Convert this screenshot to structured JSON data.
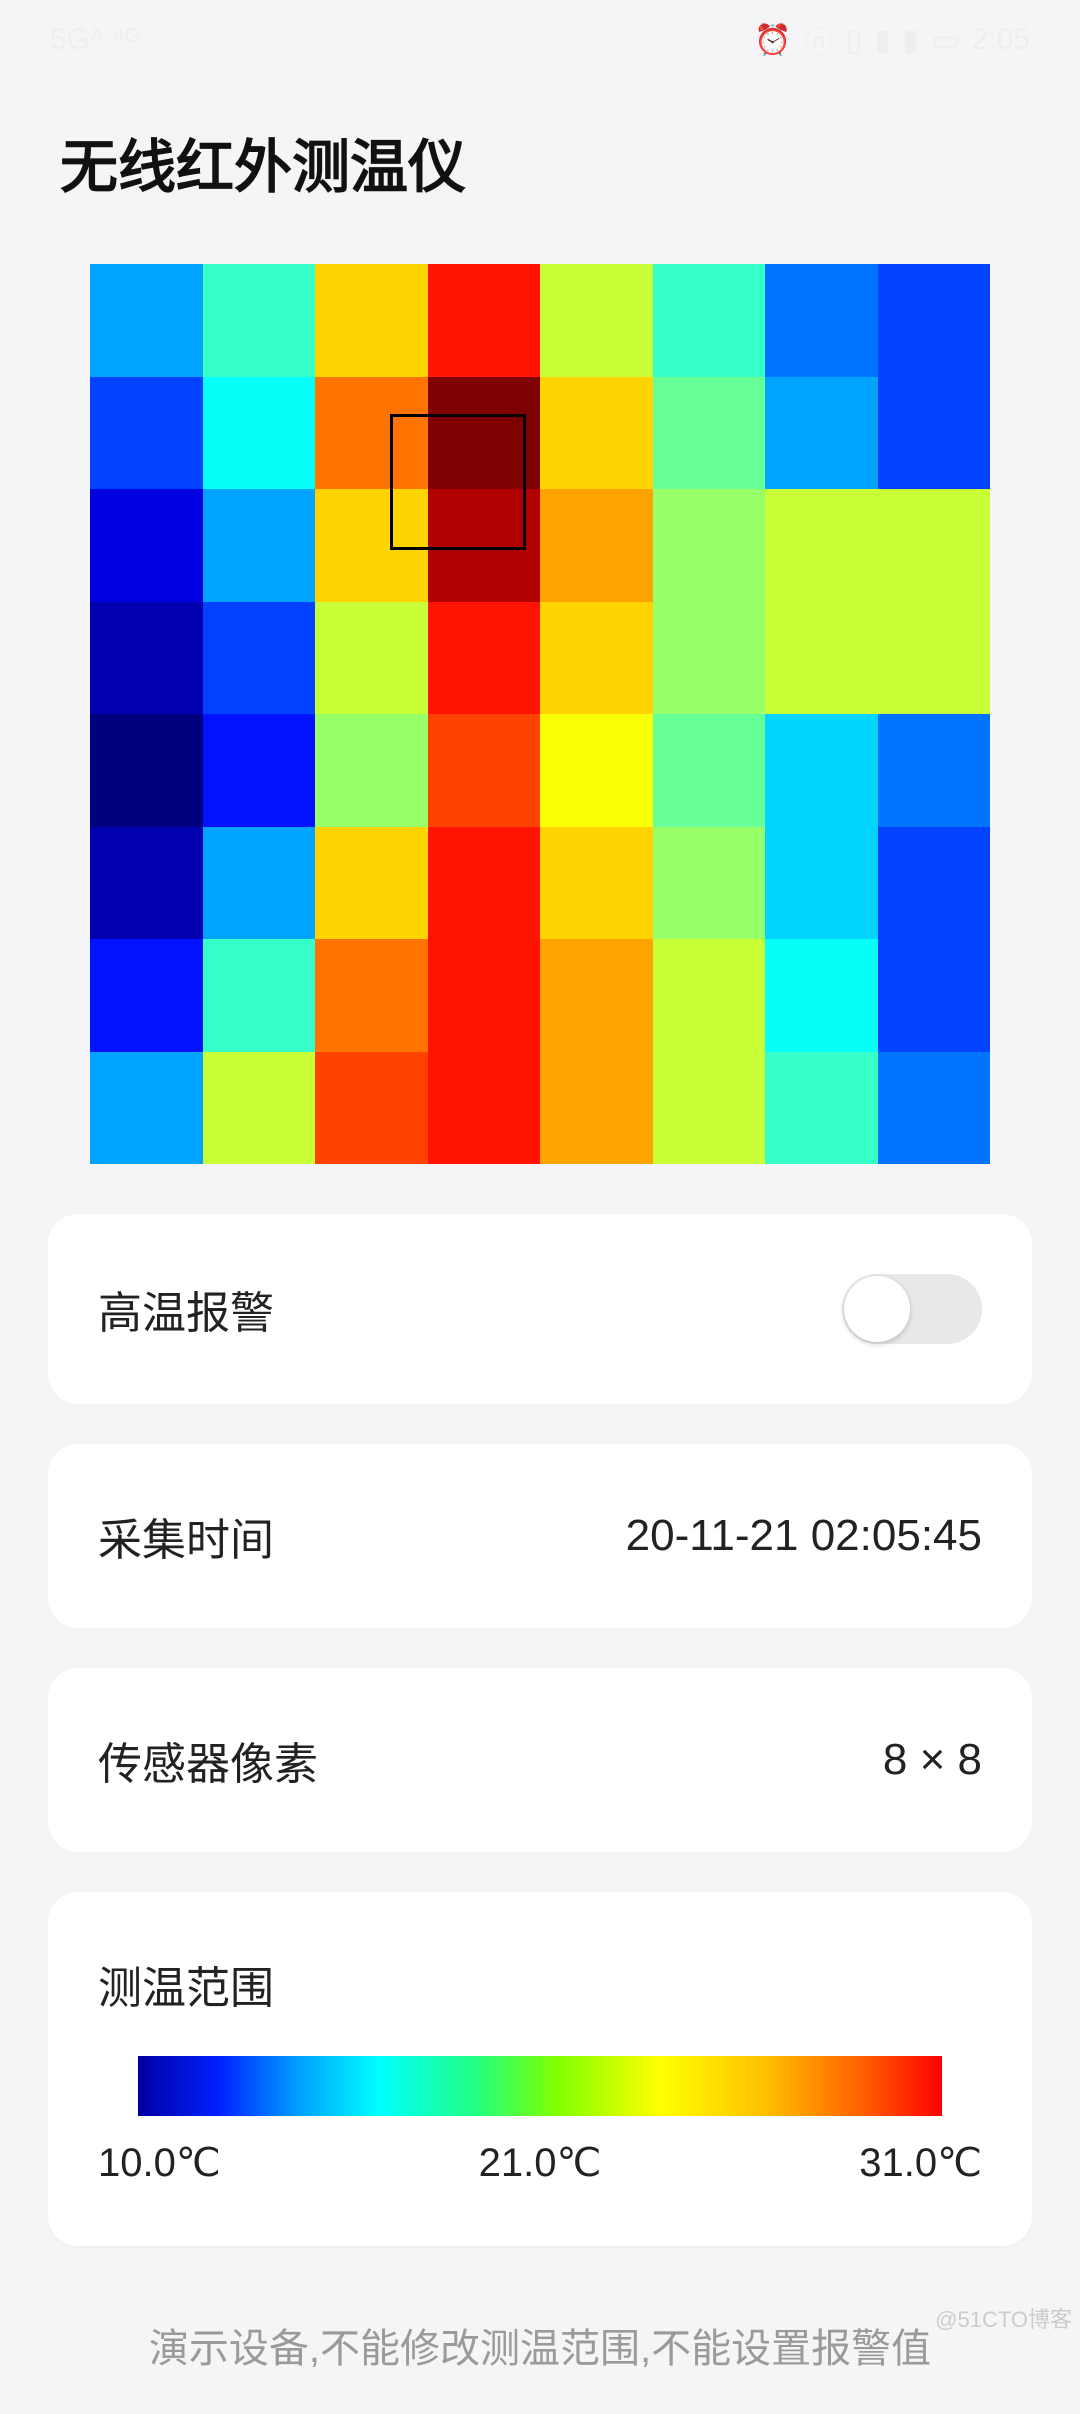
{
  "status_bar": {
    "left": "5Gᴬ ⁴ᴳ",
    "time": "2:05",
    "icons": [
      "alarm-icon",
      "nfc-icon",
      "vibrate-icon",
      "signal-icon",
      "signal-icon",
      "battery-icon"
    ]
  },
  "title": "无线红外测温仪",
  "heatmap": {
    "grid_size": 24,
    "hot_marker": {
      "row": 3,
      "col": 8,
      "span": 3
    }
  },
  "chart_data": {
    "type": "heatmap",
    "title": "无线红外测温仪",
    "xlabel": "",
    "ylabel": "",
    "value_unit": "℃",
    "value_range": [
      10.0,
      31.0
    ],
    "rows": 8,
    "cols": 8,
    "values": [
      [
        16,
        19,
        24,
        28,
        22,
        19,
        15,
        14
      ],
      [
        14,
        18,
        26,
        31,
        24,
        20,
        16,
        14
      ],
      [
        12,
        16,
        24,
        30,
        25,
        21,
        22,
        22
      ],
      [
        11,
        14,
        22,
        28,
        24,
        21,
        22,
        22
      ],
      [
        10,
        13,
        21,
        27,
        23,
        20,
        17,
        15
      ],
      [
        11,
        16,
        24,
        28,
        24,
        21,
        17,
        14
      ],
      [
        13,
        19,
        26,
        28,
        25,
        22,
        18,
        14
      ],
      [
        16,
        22,
        27,
        28,
        25,
        22,
        19,
        15
      ]
    ],
    "colormap": "jet",
    "hot_spot": {
      "row": 1,
      "col": 3,
      "value": 31
    }
  },
  "cards": {
    "alarm": {
      "label": "高温报警",
      "on": false
    },
    "time": {
      "label": "采集时间",
      "value": "20-11-21 02:05:45"
    },
    "pixel": {
      "label": "传感器像素",
      "value": "8 × 8"
    },
    "range": {
      "label": "测温范围",
      "min": "10.0℃",
      "mid": "21.0℃",
      "max": "31.0℃"
    }
  },
  "footer": "演示设备,不能修改测温范围,不能设置报警值",
  "watermark": "@51CTO博客"
}
